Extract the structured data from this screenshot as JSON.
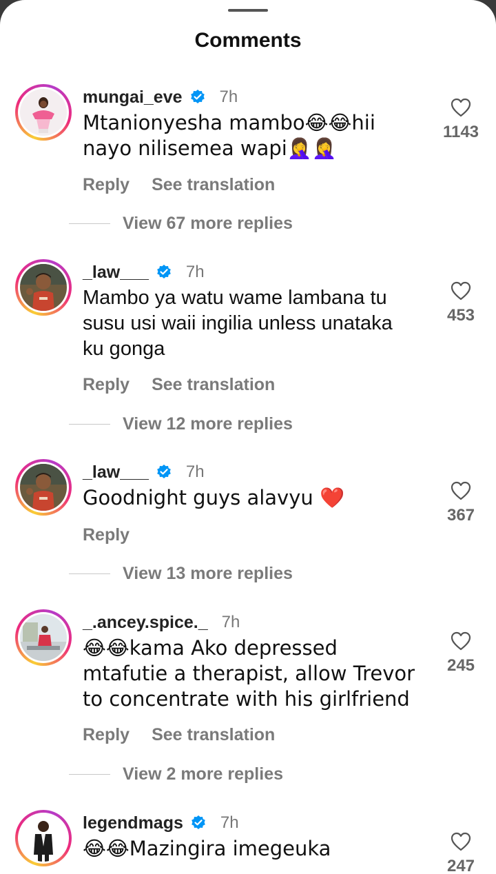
{
  "sheet": {
    "title": "Comments"
  },
  "labels": {
    "reply": "Reply",
    "see_translation": "See translation"
  },
  "comments": [
    {
      "username": "mungai_eve",
      "verified": true,
      "time": "7h",
      "text": "Mtanionyesha mambo😂😂hii nayo nilisemea wapi🤦‍♀️🤦‍♀️",
      "likes": "1143",
      "translatable": true,
      "replies_label": "View 67 more replies",
      "avatar": "woman-pink-dress"
    },
    {
      "username": "_law___",
      "verified": true,
      "time": "7h",
      "text": "Mambo ya watu wame lambana tu susu usi waii ingilia unless unataka ku gonga",
      "likes": "453",
      "translatable": true,
      "replies_label": "View 12 more replies",
      "avatar": "cartoon-kenya-jersey"
    },
    {
      "username": "_law___",
      "verified": true,
      "time": "7h",
      "text": "Goodnight guys alavyu ❤️",
      "likes": "367",
      "translatable": false,
      "replies_label": "View 13 more replies",
      "avatar": "cartoon-kenya-jersey"
    },
    {
      "username": "_.ancey.spice._",
      "verified": false,
      "time": "7h",
      "text": "😂😂kama Ako depressed mtafutie a therapist, allow Trevor to concentrate with his girlfriend",
      "likes": "245",
      "translatable": true,
      "replies_label": "View 2 more replies",
      "avatar": "person-outdoor"
    },
    {
      "username": "legendmags",
      "verified": true,
      "time": "7h",
      "text": "😂😂Mazingira imegeuka",
      "likes": "247",
      "translatable": false,
      "replies_label": "",
      "avatar": "man-suit"
    }
  ],
  "colors": {
    "verified": "#0095f6",
    "ring_start": "#f9ce34",
    "ring_mid": "#ee2a7b"
  },
  "icons": {
    "like": "heart-outline-icon",
    "verified": "verified-badge-icon"
  }
}
